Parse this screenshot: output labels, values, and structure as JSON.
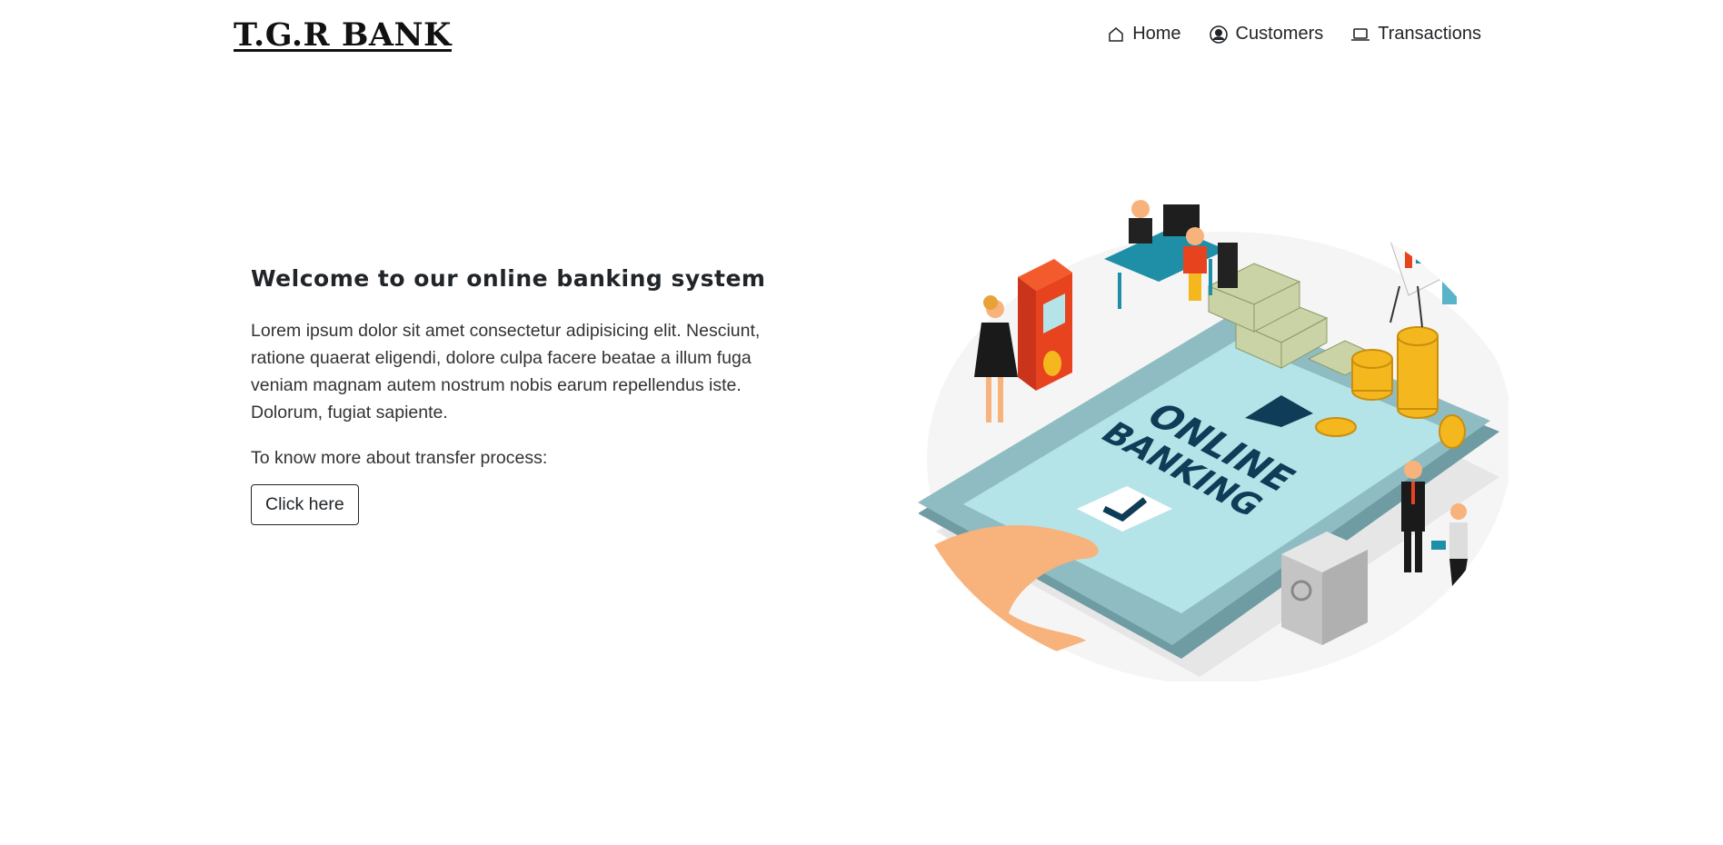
{
  "brand": {
    "name": "T.G.R BANK"
  },
  "nav": {
    "items": [
      {
        "label": "Home",
        "icon": "home-icon"
      },
      {
        "label": "Customers",
        "icon": "user-circle-icon"
      },
      {
        "label": "Transactions",
        "icon": "laptop-icon"
      }
    ]
  },
  "hero": {
    "heading": "Welcome to our online banking system",
    "paragraph": "Lorem ipsum dolor sit amet consectetur adipisicing elit. Nesciunt, ratione quaerat eligendi, dolore culpa facere beatae a illum fuga veniam magnam autem nostrum nobis earum repellendus iste. Dolorum, fugiat sapiente.",
    "subtext": "To know more about transfer process:",
    "button_label": "Click here"
  },
  "illustration": {
    "line1": "ONLINE",
    "line2": "BANKING"
  },
  "colors": {
    "phone": "#8fbcc2",
    "screen": "#b4e4e8",
    "text_dark": "#0f3c57",
    "accent_orange": "#e8431f",
    "gold": "#f4b81e"
  }
}
